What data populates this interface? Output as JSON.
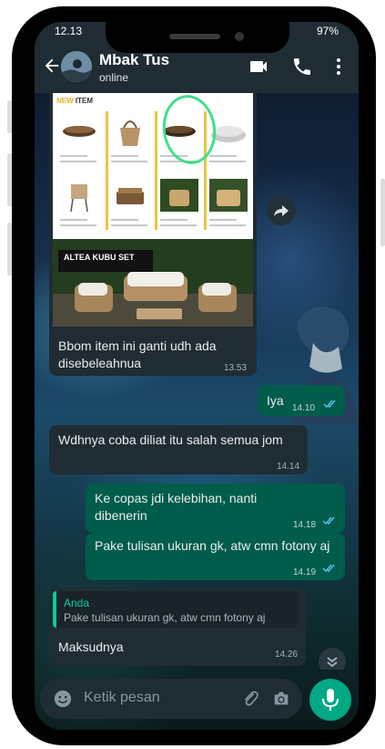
{
  "status_bar": {
    "time": "12.13",
    "battery": "97%"
  },
  "header": {
    "contact_name": "Mbak Tus",
    "status": "online"
  },
  "image_message": {
    "catalog_heading_prefix": "NEW",
    "catalog_heading": "ITEM",
    "product_title": "ALTEA KUBU SET",
    "caption": "Bbom item ini ganti udh ada disebeleahnua",
    "time": "13.53"
  },
  "messages": [
    {
      "direction": "out",
      "text": "Iya",
      "time": "14.10"
    },
    {
      "direction": "in",
      "text": "Wdhnya coba diliat itu salah semua jom",
      "time": "14.14"
    },
    {
      "direction": "out",
      "text": "Ke copas jdi kelebihan, nanti dibenerin",
      "time": "14.18"
    },
    {
      "direction": "out",
      "text": "Pake tulisan ukuran gk,  atw cmn fotony aj",
      "time": "14.19"
    }
  ],
  "reply_message": {
    "quoted_author": "Anda",
    "quoted_text": "Pake tulisan ukuran gk,  atw cmn fotony aj",
    "text": "Maksudnya",
    "time": "14.26"
  },
  "input": {
    "placeholder": "Ketik pesan"
  },
  "icons": [
    "back-arrow-icon",
    "video-call-icon",
    "phone-icon",
    "more-vert-icon",
    "forward-icon",
    "chevron-down-icon",
    "emoji-icon",
    "attach-icon",
    "camera-icon",
    "mic-icon",
    "read-ticks-icon"
  ],
  "colors": {
    "header_bg": "#1f2c34",
    "incoming_bubble": "#202c33",
    "outgoing_bubble": "#005c4b",
    "accent": "#00a884",
    "read_tick": "#53bdeb"
  }
}
